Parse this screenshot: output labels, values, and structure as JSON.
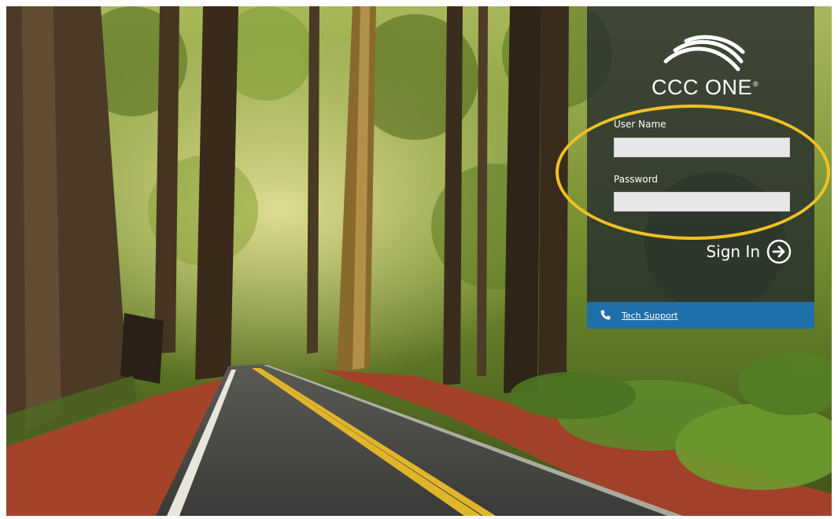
{
  "brand": {
    "name": "CCC ONE",
    "reg_mark": "®",
    "logo_icon": "signal-arcs-icon"
  },
  "login": {
    "username_label": "User Name",
    "username_value": "",
    "password_label": "Password",
    "password_value": "",
    "sign_in_label": "Sign In",
    "sign_in_icon": "circled-arrow-right-icon"
  },
  "support": {
    "label": "Tech Support",
    "icon": "phone-icon"
  },
  "colors": {
    "panel_bg": "#242b2d",
    "support_bar": "#1f6fa8",
    "input_bg": "#e8e8e8",
    "highlight_ring": "#f2c125"
  }
}
